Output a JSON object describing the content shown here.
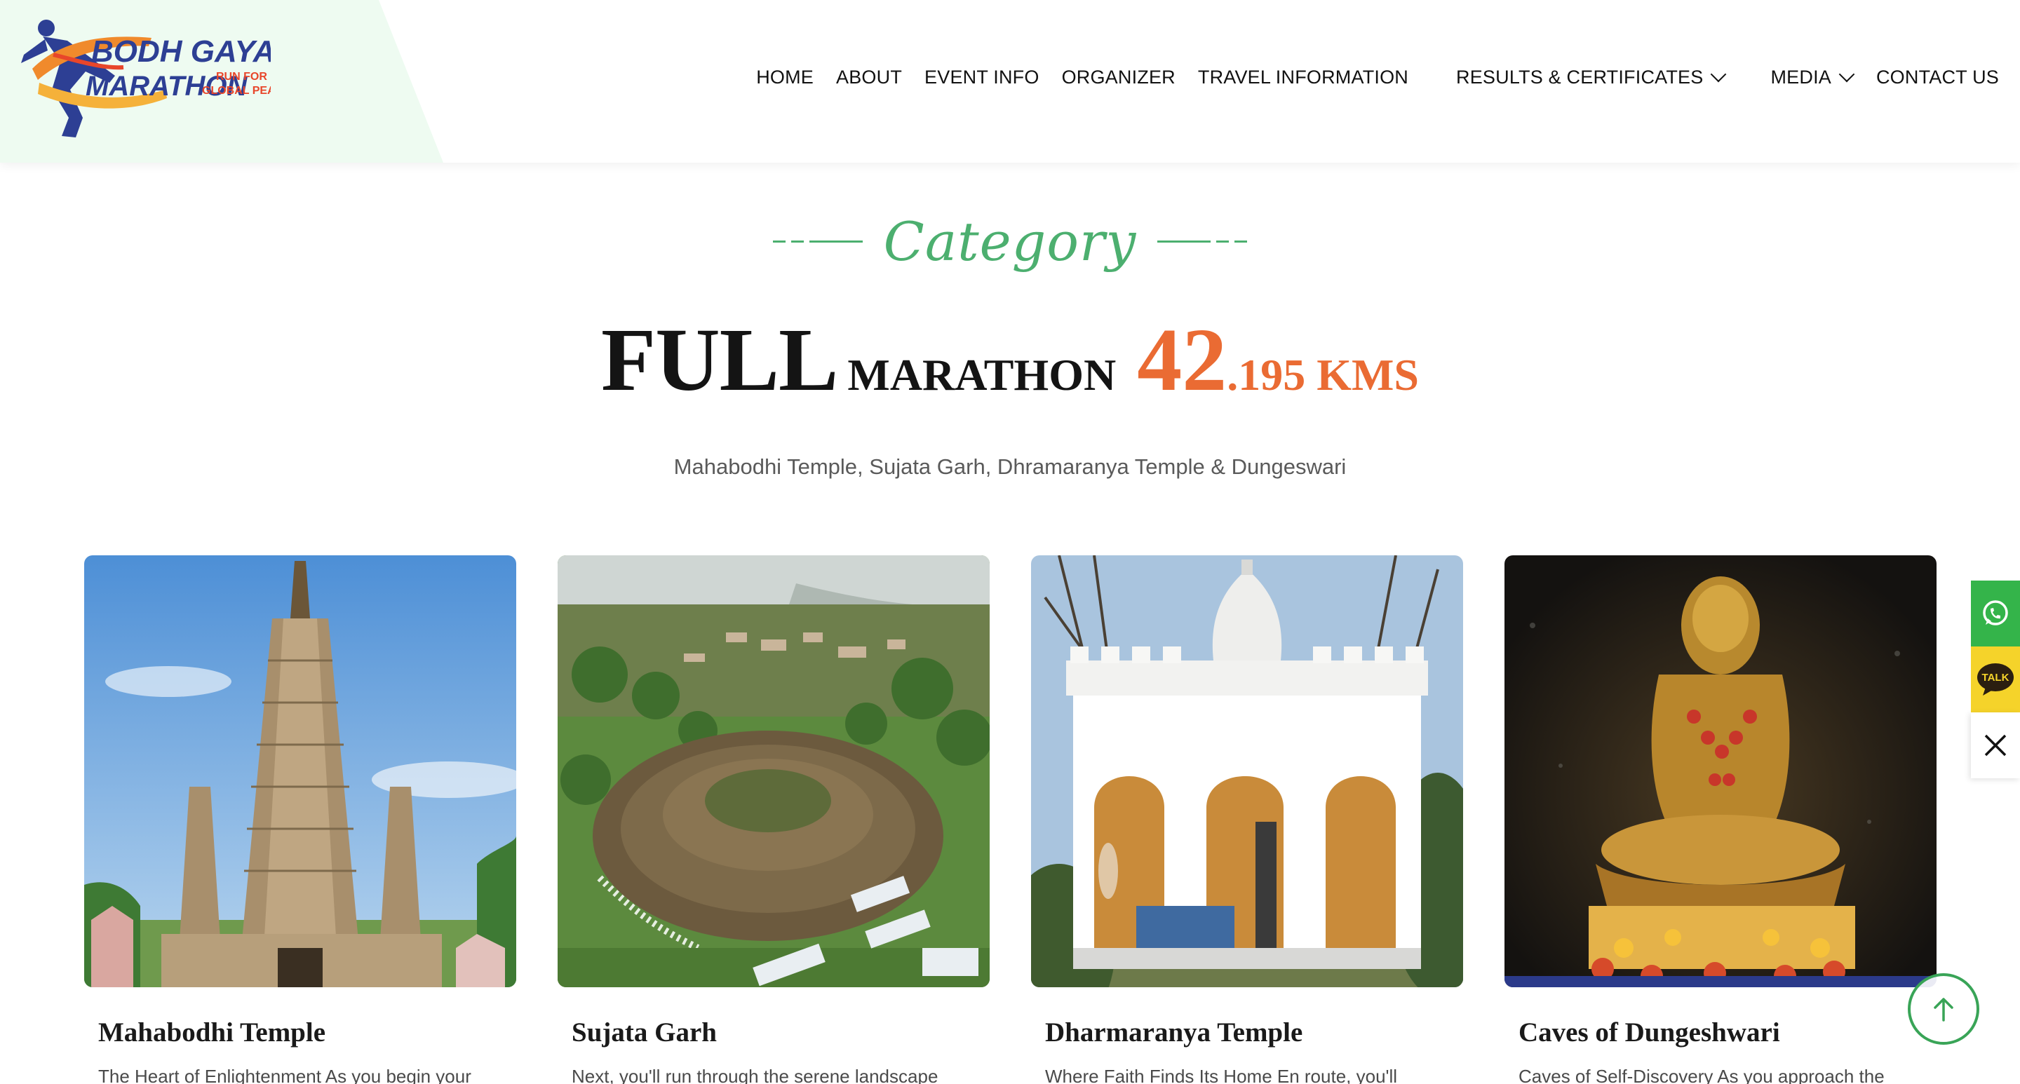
{
  "logo": {
    "line1": "BODH GAYA",
    "line2": "MARATHON",
    "tagline1": "RUN FOR",
    "tagline2": "GLOBAL PEACE"
  },
  "nav": {
    "home": "HOME",
    "about": "ABOUT",
    "event_info": "EVENT INFO",
    "organizer": "ORGANIZER",
    "travel": "TRAVEL INFORMATION",
    "results": "RESULTS & CERTIFICATES",
    "media": "MEDIA",
    "contact": "CONTACT US"
  },
  "section": {
    "eyebrow": "Category",
    "title_big": "FULL",
    "title_small": "MARATHON",
    "distance_big": "42",
    "distance_small": ".195 KMS",
    "subtitle": "Mahabodhi Temple, Sujata Garh, Dhramaranya Temple & Dungeswari"
  },
  "cards": [
    {
      "title": "Mahabodhi Temple",
      "text": "The Heart of Enlightenment As you begin your"
    },
    {
      "title": "Sujata Garh",
      "text": "Next, you'll run through the serene landscape"
    },
    {
      "title": "Dharmaranya Temple",
      "text": "Where Faith Finds Its Home En route, you'll"
    },
    {
      "title": "Caves of Dungeshwari",
      "text": "Caves of Self-Discovery As you approach the"
    }
  ],
  "side_buttons": {
    "whatsapp_icon": "whatsapp-icon",
    "talk_label": "TALK",
    "close_icon": "close-icon"
  },
  "colors": {
    "accent_green": "#4caf6f",
    "accent_orange": "#ea6b33",
    "whatsapp": "#34b44a",
    "talk": "#f5d32a"
  }
}
